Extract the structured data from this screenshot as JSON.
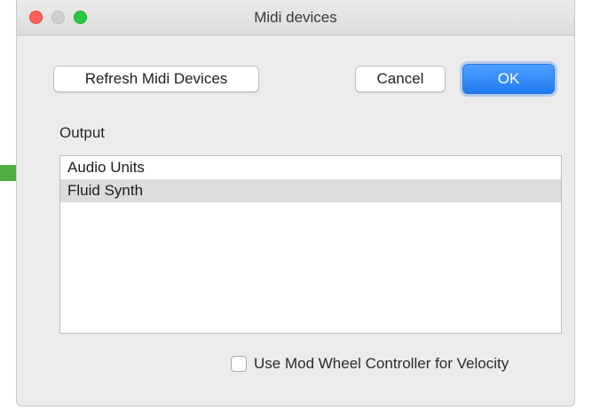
{
  "window": {
    "title": "Midi devices"
  },
  "buttons": {
    "refresh_label": "Refresh Midi Devices",
    "cancel_label": "Cancel",
    "ok_label": "OK"
  },
  "output": {
    "label": "Output",
    "items": [
      {
        "label": "Audio Units",
        "selected": false
      },
      {
        "label": "Fluid Synth",
        "selected": true
      }
    ]
  },
  "velocity_option": {
    "label": "Use Mod Wheel Controller for Velocity",
    "checked": false
  },
  "annotation": {
    "arrow_color": "#4caf3d",
    "icon": "arrow-right-icon"
  },
  "colors": {
    "accent": "#1f7bf2",
    "close": "#fd5f57",
    "zoom": "#28c840",
    "selection": "#dcdcdc"
  }
}
